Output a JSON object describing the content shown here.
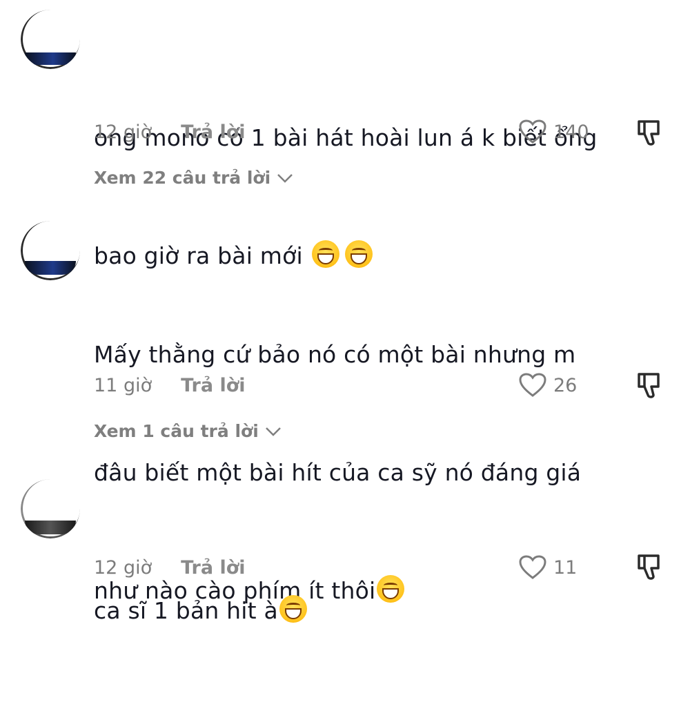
{
  "comments": [
    {
      "lines": [
        "ong mono có 1 bài hát hoài lun á k biết ổng",
        "bao giờ ra bài mới "
      ],
      "emojis": [
        "sweat-smile-emoji",
        "sweat-smile-emoji"
      ],
      "time": "12 giờ",
      "reply_label": "Trả lời",
      "likes": "140",
      "view_replies": "Xem 22 câu trả lời"
    },
    {
      "lines": [
        "Mấy thằng cứ bảo nó có một bài nhưng m",
        "đâu biết một bài hít của ca sỹ nó đáng giá",
        "như nào cào phím ít thôi"
      ],
      "emojis": [
        "tears-of-joy-emoji"
      ],
      "time": "11 giờ",
      "reply_label": "Trả lời",
      "likes": "26",
      "view_replies": "Xem 1 câu trả lời"
    },
    {
      "lines": [
        "ca sĩ 1 bản hit à"
      ],
      "emojis": [
        "grin-emoji"
      ],
      "time": "12 giờ",
      "reply_label": "Trả lời",
      "likes": "11"
    }
  ],
  "icons": {
    "like": "heart-outline-icon",
    "dislike": "thumbs-down-icon",
    "expand": "chevron-down-icon"
  },
  "colors": {
    "text": "#161823",
    "meta": "#7c7c7c",
    "background": "#ffffff"
  }
}
